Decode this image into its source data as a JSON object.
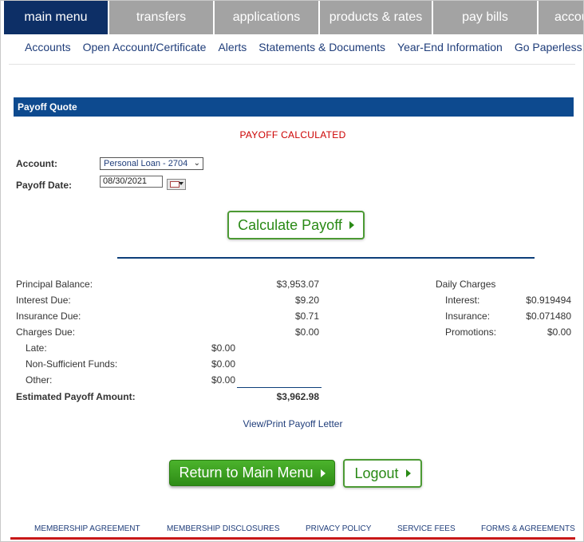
{
  "nav": {
    "tabs": [
      {
        "label": "main menu",
        "active": true
      },
      {
        "label": "transfers",
        "active": false
      },
      {
        "label": "applications",
        "active": false
      },
      {
        "label": "products & rates",
        "active": false
      },
      {
        "label": "pay bills",
        "active": false
      },
      {
        "label": "accou",
        "active": false
      }
    ],
    "subnav": [
      "Accounts",
      "Open Account/Certificate",
      "Alerts",
      "Statements & Documents",
      "Year-End Information",
      "Go Paperless!"
    ]
  },
  "section": {
    "title": "Payoff Quote"
  },
  "status": "PAYOFF CALCULATED",
  "form": {
    "account_label": "Account:",
    "account_value": "Personal Loan - 2704",
    "date_label": "Payoff Date:",
    "date_value": "08/30/2021",
    "calculate_label": "Calculate Payoff"
  },
  "breakdown": {
    "principal": {
      "label": "Principal Balance:",
      "value": "$3,953.07"
    },
    "interest": {
      "label": "Interest Due:",
      "value": "$9.20"
    },
    "insurance": {
      "label": "Insurance Due:",
      "value": "$0.71"
    },
    "charges": {
      "label": "Charges Due:",
      "value": "$0.00"
    },
    "late": {
      "label": "Late:",
      "value": "$0.00"
    },
    "nsf": {
      "label": "Non-Sufficient Funds:",
      "value": "$0.00"
    },
    "other": {
      "label": "Other:",
      "value": "$0.00"
    },
    "total": {
      "label": "Estimated Payoff Amount:",
      "value": "$3,962.98"
    }
  },
  "daily": {
    "title": "Daily Charges",
    "interest": {
      "label": "Interest:",
      "value": "$0.919494"
    },
    "insurance": {
      "label": "Insurance:",
      "value": "$0.071480"
    },
    "promotions": {
      "label": "Promotions:",
      "value": "$0.00"
    }
  },
  "letter_link": "View/Print Payoff Letter",
  "actions": {
    "return_label": "Return to Main Menu",
    "logout_label": "Logout"
  },
  "footer": [
    "MEMBERSHIP AGREEMENT",
    "MEMBERSHIP DISCLOSURES",
    "PRIVACY POLICY",
    "SERVICE FEES",
    "FORMS & AGREEMENTS"
  ],
  "colors": {
    "nav_active": "#0d2f66",
    "section_bar": "#0d4a8f",
    "status": "#cc0000",
    "button_green": "#2e8c16",
    "footer_rule": "#c81818"
  }
}
